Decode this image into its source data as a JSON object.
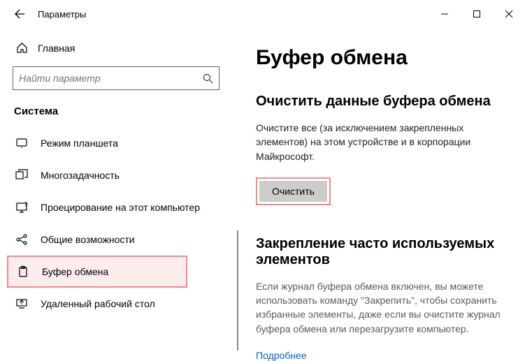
{
  "window": {
    "title": "Параметры"
  },
  "sidebar": {
    "home_label": "Главная",
    "search_placeholder": "Найти параметр",
    "section": "Система",
    "items": [
      {
        "label": "Режим планшета"
      },
      {
        "label": "Многозадачность"
      },
      {
        "label": "Проецирование на этот компьютер"
      },
      {
        "label": "Общие возможности"
      },
      {
        "label": "Буфер обмена"
      },
      {
        "label": "Удаленный рабочий стол"
      }
    ]
  },
  "main": {
    "page_title": "Буфер обмена",
    "clear_section": {
      "title": "Очистить данные буфера обмена",
      "desc": "Очистите все (за исключением закрепленных элементов) на этом устройстве и в корпорации Майкрософт.",
      "button": "Очистить"
    },
    "pin_section": {
      "title": "Закрепление часто используемых элементов",
      "desc": "Если журнал буфера обмена включен, вы можете использовать команду \"Закрепить\", чтобы сохранить избранные элементы, даже если вы очистите журнал буфера обмена или перезагрузите компьютер.",
      "link": "Подробнее"
    }
  }
}
